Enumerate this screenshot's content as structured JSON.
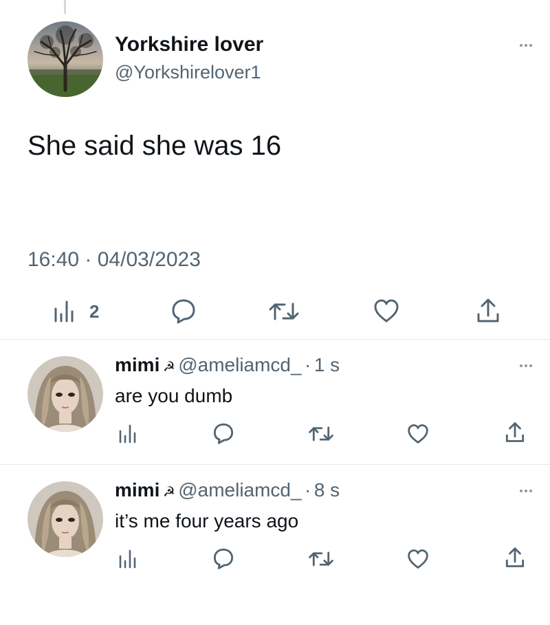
{
  "main_tweet": {
    "display_name": "Yorkshire lover",
    "handle": "@Yorkshirelover1",
    "text": "She said she was 16",
    "timestamp": "16:40 · 04/03/2023",
    "actions": {
      "views_icon": "bar-chart-icon",
      "views_count": "2",
      "reply_icon": "speech-bubble-icon",
      "retweet_icon": "retweet-icon",
      "like_icon": "heart-icon",
      "share_icon": "share-upload-icon"
    }
  },
  "replies": [
    {
      "display_name": "mimi",
      "name_emoji": "☭",
      "handle": "@ameliamcd_",
      "separator": "·",
      "time": "1 s",
      "text": "are you dumb"
    },
    {
      "display_name": "mimi",
      "name_emoji": "☭",
      "handle": "@ameliamcd_",
      "separator": "·",
      "time": "8 s",
      "text": "it’s me four years ago"
    }
  ],
  "colors": {
    "text_primary": "#0f1419",
    "text_secondary": "#536471",
    "icon_gray": "#536471",
    "divider": "#e4e8eb"
  }
}
